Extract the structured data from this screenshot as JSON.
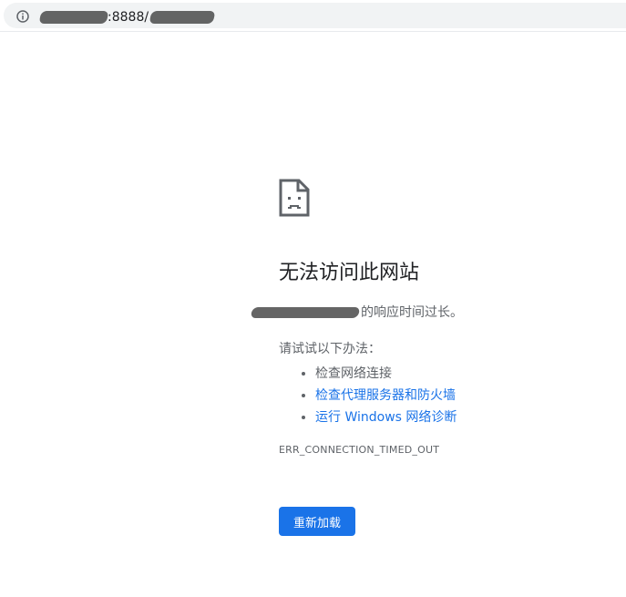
{
  "address_bar": {
    "url_visible_fragment": ":8888/",
    "icon": "info-icon"
  },
  "error_page": {
    "icon": "sad-page-icon",
    "heading": "无法访问此网站",
    "summary_suffix": "的响应时间过长。",
    "suggestions_intro": "请试试以下办法：",
    "suggestions": [
      {
        "label": "检查网络连接",
        "is_link": false
      },
      {
        "label": "检查代理服务器和防火墙",
        "is_link": true
      },
      {
        "label": "运行 Windows 网络诊断",
        "is_link": true
      }
    ],
    "error_code": "ERR_CONNECTION_TIMED_OUT",
    "reload_label": "重新加载"
  },
  "colors": {
    "accent": "#1a73e8",
    "text_primary": "#202124",
    "text_secondary": "#5f6368"
  }
}
